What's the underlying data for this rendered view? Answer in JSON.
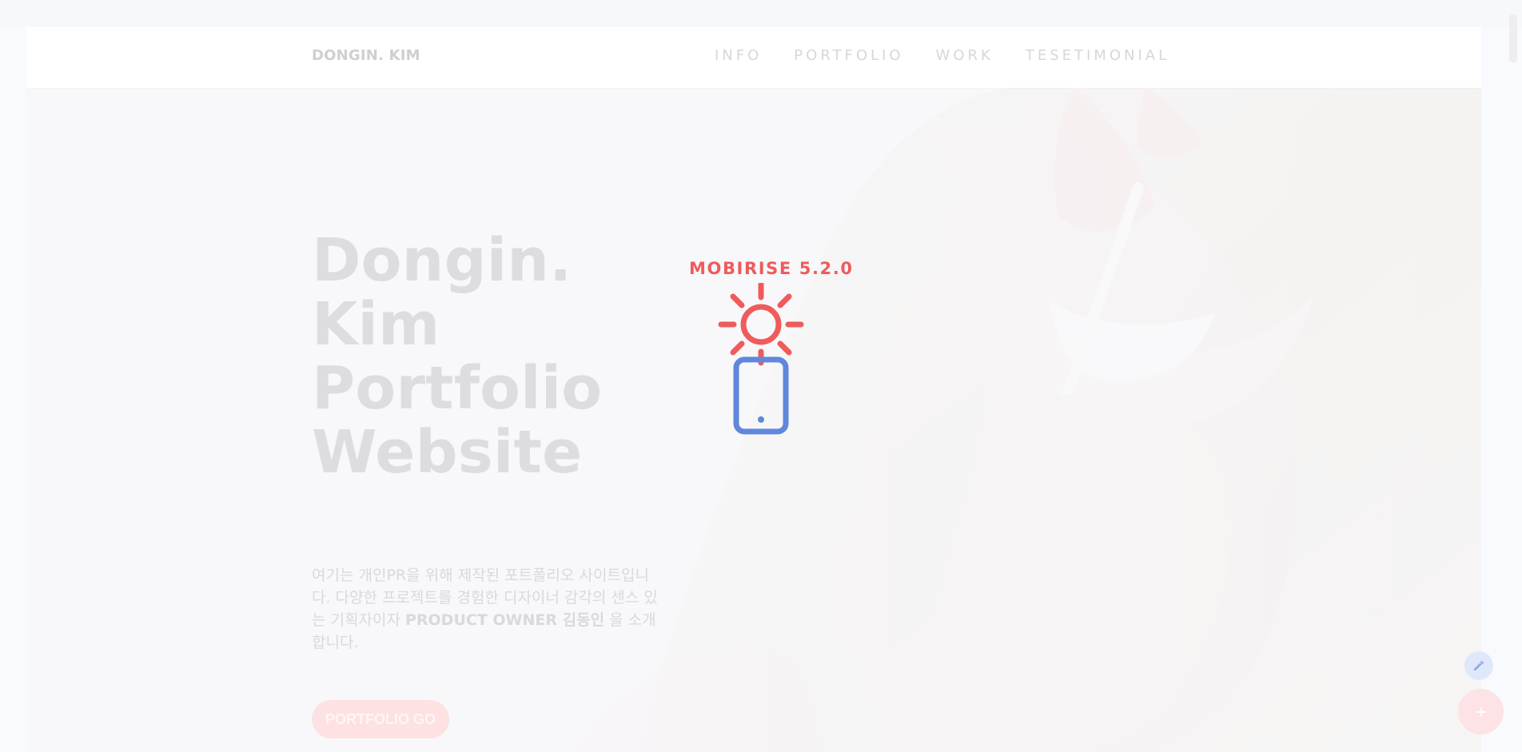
{
  "navbar": {
    "brand": "DONGIN. KIM",
    "links": [
      "INFO",
      "PORTFOLIO",
      "WORK",
      "TESETIMONIAL"
    ]
  },
  "hero": {
    "title_line_1": "Dongin. Kim",
    "title_line_2": "Portfolio",
    "title_line_3": "Website",
    "description_part_1": "여기는 개인PR을 위해 제작된 포트폴리오 사이트입니다. 다양한 프로젝트를 경험한 디자이너 감각의 센스 있는 기획자이자",
    "description_strong": "PRODUCT OWNER 김동인",
    "description_part_2": "을 소개합니다.",
    "button": "PORTFOLIO GO"
  },
  "badge": {
    "text": "MOBIRISE 5.2.0"
  },
  "floating_actions": {
    "edit_icon": "pencil-icon",
    "add_icon": "plus-icon"
  },
  "colors": {
    "accent_red": "#ef5b5b",
    "accent_blue": "#5f87dc",
    "button_bg": "#fde1e3"
  }
}
